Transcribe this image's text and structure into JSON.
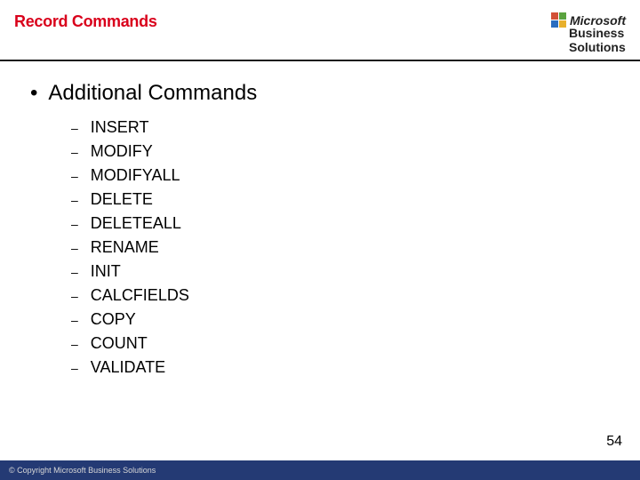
{
  "header": {
    "title": "Record Commands",
    "brand_top": "Microsoft",
    "brand_mid": "Business",
    "brand_bot": "Solutions"
  },
  "content": {
    "main_bullet": "Additional Commands",
    "items": [
      "INSERT",
      "MODIFY",
      "MODIFYALL",
      "DELETE",
      "DELETEALL",
      "RENAME",
      "INIT",
      "CALCFIELDS",
      "COPY",
      "COUNT",
      "VALIDATE"
    ]
  },
  "page_number": "54",
  "footer": "© Copyright Microsoft Business Solutions"
}
